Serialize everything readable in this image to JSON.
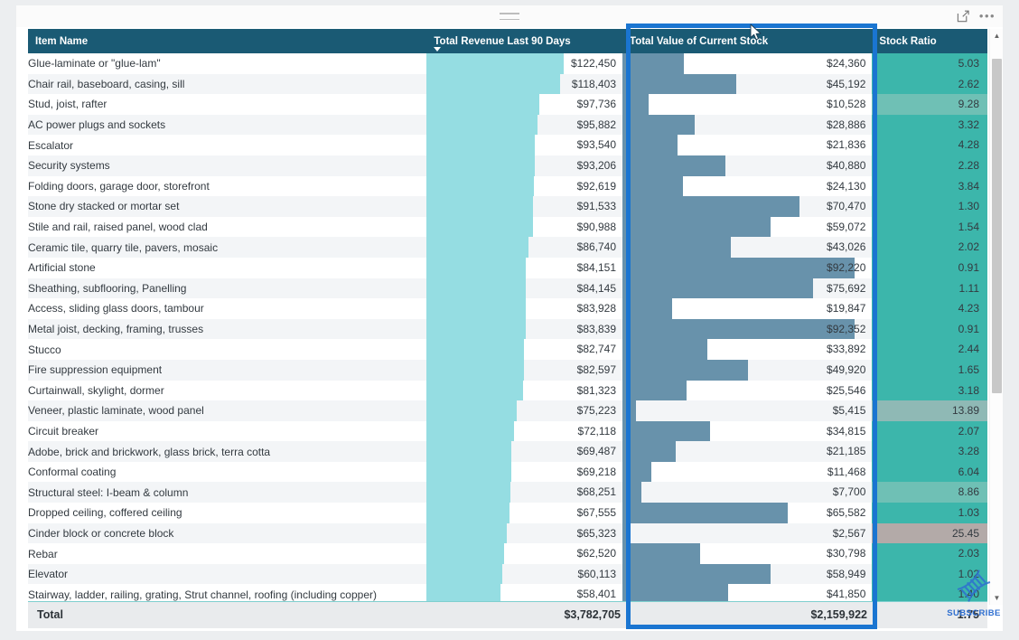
{
  "header": {
    "drag_handle": "drag-handle",
    "focus_mode_label": "Focus mode",
    "more_options_label": "More options"
  },
  "table": {
    "columns": [
      {
        "key": "item",
        "label": "Item Name",
        "sorted": false
      },
      {
        "key": "revenue",
        "label": "Total Revenue Last 90 Days",
        "sorted": true,
        "sort_dir": "desc"
      },
      {
        "key": "stock",
        "label": "Total Value of Current Stock",
        "sorted": false
      },
      {
        "key": "ratio",
        "label": "Stock Ratio",
        "sorted": false
      }
    ],
    "rows": [
      {
        "item": "Glue-laminate or \"glue-lam\"",
        "revenue": "$122,450",
        "revenue_n": 122450,
        "stock": "$24,360",
        "stock_n": 24360,
        "ratio": "5.03",
        "ratio_n": 5.03
      },
      {
        "item": "Chair rail, baseboard, casing, sill",
        "revenue": "$118,403",
        "revenue_n": 118403,
        "stock": "$45,192",
        "stock_n": 45192,
        "ratio": "2.62",
        "ratio_n": 2.62
      },
      {
        "item": "Stud, joist, rafter",
        "revenue": "$97,736",
        "revenue_n": 97736,
        "stock": "$10,528",
        "stock_n": 10528,
        "ratio": "9.28",
        "ratio_n": 9.28
      },
      {
        "item": "AC power plugs and sockets",
        "revenue": "$95,882",
        "revenue_n": 95882,
        "stock": "$28,886",
        "stock_n": 28886,
        "ratio": "3.32",
        "ratio_n": 3.32
      },
      {
        "item": "Escalator",
        "revenue": "$93,540",
        "revenue_n": 93540,
        "stock": "$21,836",
        "stock_n": 21836,
        "ratio": "4.28",
        "ratio_n": 4.28
      },
      {
        "item": "Security systems",
        "revenue": "$93,206",
        "revenue_n": 93206,
        "stock": "$40,880",
        "stock_n": 40880,
        "ratio": "2.28",
        "ratio_n": 2.28
      },
      {
        "item": "Folding doors, garage door, storefront",
        "revenue": "$92,619",
        "revenue_n": 92619,
        "stock": "$24,130",
        "stock_n": 24130,
        "ratio": "3.84",
        "ratio_n": 3.84
      },
      {
        "item": "Stone dry stacked or mortar set",
        "revenue": "$91,533",
        "revenue_n": 91533,
        "stock": "$70,470",
        "stock_n": 70470,
        "ratio": "1.30",
        "ratio_n": 1.3
      },
      {
        "item": "Stile and rail, raised panel, wood clad",
        "revenue": "$90,988",
        "revenue_n": 90988,
        "stock": "$59,072",
        "stock_n": 59072,
        "ratio": "1.54",
        "ratio_n": 1.54
      },
      {
        "item": "Ceramic tile, quarry tile, pavers, mosaic",
        "revenue": "$86,740",
        "revenue_n": 86740,
        "stock": "$43,026",
        "stock_n": 43026,
        "ratio": "2.02",
        "ratio_n": 2.02
      },
      {
        "item": "Artificial stone",
        "revenue": "$84,151",
        "revenue_n": 84151,
        "stock": "$92,220",
        "stock_n": 92220,
        "ratio": "0.91",
        "ratio_n": 0.91
      },
      {
        "item": "Sheathing, subflooring, Panelling",
        "revenue": "$84,145",
        "revenue_n": 84145,
        "stock": "$75,692",
        "stock_n": 75692,
        "ratio": "1.11",
        "ratio_n": 1.11
      },
      {
        "item": "Access, sliding glass doors, tambour",
        "revenue": "$83,928",
        "revenue_n": 83928,
        "stock": "$19,847",
        "stock_n": 19847,
        "ratio": "4.23",
        "ratio_n": 4.23
      },
      {
        "item": "Metal joist, decking, framing, trusses",
        "revenue": "$83,839",
        "revenue_n": 83839,
        "stock": "$92,352",
        "stock_n": 92352,
        "ratio": "0.91",
        "ratio_n": 0.91
      },
      {
        "item": "Stucco",
        "revenue": "$82,747",
        "revenue_n": 82747,
        "stock": "$33,892",
        "stock_n": 33892,
        "ratio": "2.44",
        "ratio_n": 2.44
      },
      {
        "item": "Fire suppression equipment",
        "revenue": "$82,597",
        "revenue_n": 82597,
        "stock": "$49,920",
        "stock_n": 49920,
        "ratio": "1.65",
        "ratio_n": 1.65
      },
      {
        "item": "Curtainwall, skylight, dormer",
        "revenue": "$81,323",
        "revenue_n": 81323,
        "stock": "$25,546",
        "stock_n": 25546,
        "ratio": "3.18",
        "ratio_n": 3.18
      },
      {
        "item": "Veneer, plastic laminate, wood panel",
        "revenue": "$75,223",
        "revenue_n": 75223,
        "stock": "$5,415",
        "stock_n": 5415,
        "ratio": "13.89",
        "ratio_n": 13.89
      },
      {
        "item": "Circuit breaker",
        "revenue": "$72,118",
        "revenue_n": 72118,
        "stock": "$34,815",
        "stock_n": 34815,
        "ratio": "2.07",
        "ratio_n": 2.07
      },
      {
        "item": "Adobe, brick and brickwork, glass brick, terra cotta",
        "revenue": "$69,487",
        "revenue_n": 69487,
        "stock": "$21,185",
        "stock_n": 21185,
        "ratio": "3.28",
        "ratio_n": 3.28
      },
      {
        "item": "Conformal coating",
        "revenue": "$69,218",
        "revenue_n": 69218,
        "stock": "$11,468",
        "stock_n": 11468,
        "ratio": "6.04",
        "ratio_n": 6.04
      },
      {
        "item": "Structural steel: I-beam & column",
        "revenue": "$68,251",
        "revenue_n": 68251,
        "stock": "$7,700",
        "stock_n": 7700,
        "ratio": "8.86",
        "ratio_n": 8.86
      },
      {
        "item": "Dropped ceiling, coffered ceiling",
        "revenue": "$67,555",
        "revenue_n": 67555,
        "stock": "$65,582",
        "stock_n": 65582,
        "ratio": "1.03",
        "ratio_n": 1.03
      },
      {
        "item": "Cinder block or concrete block",
        "revenue": "$65,323",
        "revenue_n": 65323,
        "stock": "$2,567",
        "stock_n": 2567,
        "ratio": "25.45",
        "ratio_n": 25.45
      },
      {
        "item": "Rebar",
        "revenue": "$62,520",
        "revenue_n": 62520,
        "stock": "$30,798",
        "stock_n": 30798,
        "ratio": "2.03",
        "ratio_n": 2.03
      },
      {
        "item": "Elevator",
        "revenue": "$60,113",
        "revenue_n": 60113,
        "stock": "$58,949",
        "stock_n": 58949,
        "ratio": "1.02",
        "ratio_n": 1.02
      },
      {
        "item": "Stairway, ladder, railing, grating, Strut channel, roofing (including copper)",
        "revenue": "$58,401",
        "revenue_n": 58401,
        "stock": "$41,850",
        "stock_n": 41850,
        "ratio": "1.40",
        "ratio_n": 1.4
      }
    ],
    "total": {
      "label": "Total",
      "revenue": "$3,782,705",
      "stock": "$2,159,922",
      "ratio": "1.75"
    }
  },
  "chart_data": {
    "type": "table",
    "title": "Item Name / Total Revenue Last 90 Days / Total Value of Current Stock / Stock Ratio",
    "columns": [
      "Item Name",
      "Total Revenue Last 90 Days",
      "Total Value of Current Stock",
      "Stock Ratio"
    ],
    "categories": [
      "Glue-laminate or \"glue-lam\"",
      "Chair rail, baseboard, casing, sill",
      "Stud, joist, rafter",
      "AC power plugs and sockets",
      "Escalator",
      "Security systems",
      "Folding doors, garage door, storefront",
      "Stone dry stacked or mortar set",
      "Stile and rail, raised panel, wood clad",
      "Ceramic tile, quarry tile, pavers, mosaic",
      "Artificial stone",
      "Sheathing, subflooring, Panelling",
      "Access, sliding glass doors, tambour",
      "Metal joist, decking, framing, trusses",
      "Stucco",
      "Fire suppression equipment",
      "Curtainwall, skylight, dormer",
      "Veneer, plastic laminate, wood panel",
      "Circuit breaker",
      "Adobe, brick and brickwork, glass brick, terra cotta",
      "Conformal coating",
      "Structural steel: I-beam & column",
      "Dropped ceiling, coffered ceiling",
      "Cinder block or concrete block",
      "Rebar",
      "Elevator",
      "Stairway, ladder, railing, grating, Strut channel, roofing (including copper)"
    ],
    "series": [
      {
        "name": "Total Revenue Last 90 Days",
        "color": "#95dde2",
        "values": [
          122450,
          118403,
          97736,
          95882,
          93540,
          93206,
          92619,
          91533,
          90988,
          86740,
          84151,
          84145,
          83928,
          83839,
          82747,
          82597,
          81323,
          75223,
          72118,
          69487,
          69218,
          68251,
          67555,
          65323,
          62520,
          60113,
          58401
        ]
      },
      {
        "name": "Total Value of Current Stock",
        "color": "#6892ab",
        "values": [
          24360,
          45192,
          10528,
          28886,
          21836,
          40880,
          24130,
          70470,
          59072,
          43026,
          92220,
          75692,
          19847,
          92352,
          33892,
          49920,
          25546,
          5415,
          34815,
          21185,
          11468,
          7700,
          65582,
          2567,
          30798,
          58949,
          41850
        ]
      },
      {
        "name": "Stock Ratio",
        "color": "#3cb6ab",
        "values": [
          5.03,
          2.62,
          9.28,
          3.32,
          4.28,
          2.28,
          3.84,
          1.3,
          1.54,
          2.02,
          0.91,
          1.11,
          4.23,
          0.91,
          2.44,
          1.65,
          3.18,
          13.89,
          2.07,
          3.28,
          6.04,
          8.86,
          1.03,
          25.45,
          2.03,
          1.02,
          1.4
        ]
      }
    ],
    "totals": {
      "Total Revenue Last 90 Days": 3782705,
      "Total Value of Current Stock": 2159922,
      "Stock Ratio": 1.75
    },
    "sorted_by": "Total Revenue Last 90 Days",
    "sort_direction": "descending"
  },
  "scrollbar": {
    "up_arrow": "chevron-up-icon",
    "down_arrow": "chevron-down-icon"
  },
  "watermark": {
    "text": "SUBSCRIBE"
  },
  "colors": {
    "header_bg": "#1a5a74",
    "revenue_bar": "#95dde2",
    "stock_bar": "#6892ab",
    "ratio_fill": "#3cb6ab",
    "ratio_fill_muted": "#8fb9b5",
    "ratio_fill_high": "#b3aaa8",
    "selection_border": "#1a75d1",
    "row_alt": "#f3f5f7"
  }
}
